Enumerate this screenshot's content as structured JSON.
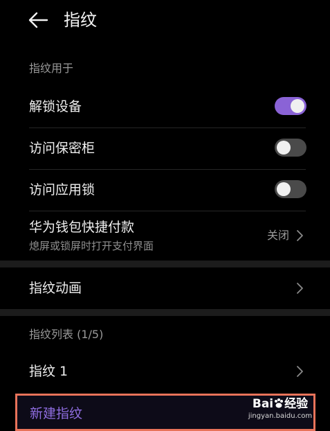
{
  "header": {
    "title": "指纹",
    "back_icon": "arrow-left-icon"
  },
  "section_fingerprint_use": {
    "label": "指纹用于",
    "items": [
      {
        "label": "解锁设备",
        "control": "toggle",
        "state": "on"
      },
      {
        "label": "访问保密柜",
        "control": "toggle",
        "state": "off"
      },
      {
        "label": "访问应用锁",
        "control": "toggle",
        "state": "off"
      }
    ]
  },
  "wallet": {
    "label": "华为钱包快捷付款",
    "subtitle": "熄屏或锁屏时打开支付界面",
    "value": "关闭"
  },
  "animation": {
    "label": "指纹动画"
  },
  "fingerprint_list": {
    "label": "指纹列表 (1/5)",
    "items": [
      {
        "label": "指纹 1"
      }
    ],
    "add_label": "新建指纹"
  },
  "watermark": {
    "main": "Bai",
    "main_suffix": "经验",
    "sub": "jingyan.baidu.com"
  },
  "colors": {
    "accent": "#8a63d6",
    "highlight_border": "#e8735a",
    "background": "#000000"
  }
}
